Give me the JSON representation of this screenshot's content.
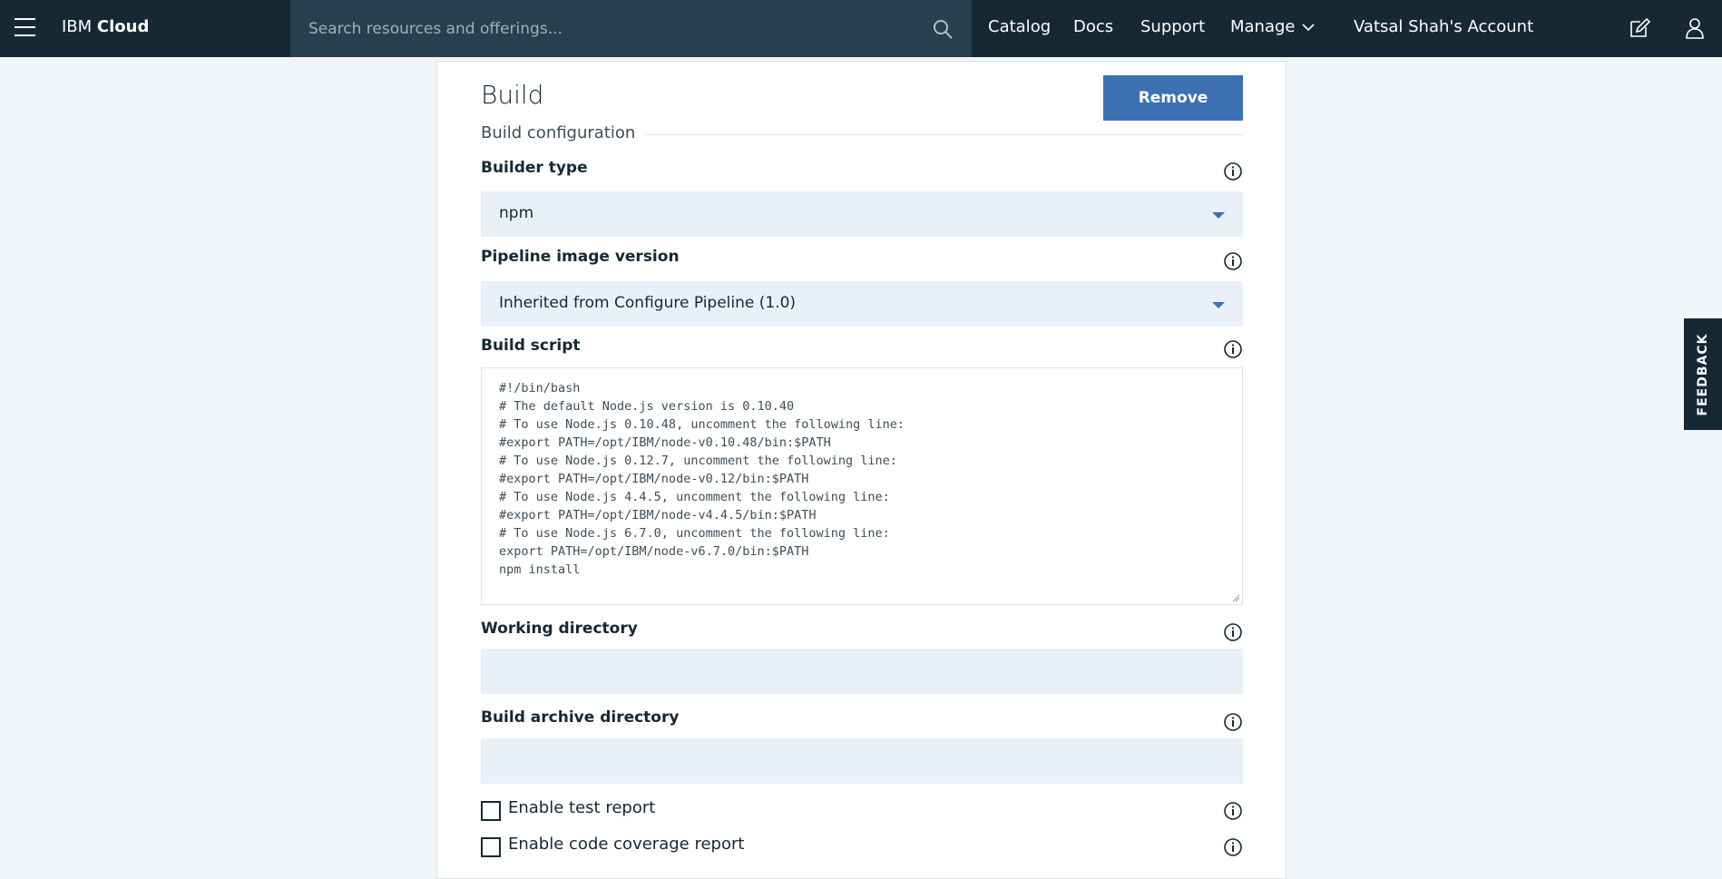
{
  "header": {
    "brand_prefix": "IBM",
    "brand_name": "Cloud",
    "search_placeholder": "Search resources and offerings...",
    "nav": {
      "catalog": "Catalog",
      "docs": "Docs",
      "support": "Support",
      "manage": "Manage",
      "account": "Vatsal Shah's Account"
    }
  },
  "panel": {
    "title": "Build",
    "remove_label": "Remove",
    "section_title": "Build configuration",
    "builder_type": {
      "label": "Builder type",
      "value": "npm"
    },
    "pipeline_image": {
      "label": "Pipeline image version",
      "value": "Inherited from Configure Pipeline (1.0)"
    },
    "build_script": {
      "label": "Build script",
      "value": "#!/bin/bash\n# The default Node.js version is 0.10.40\n# To use Node.js 0.10.48, uncomment the following line:\n#export PATH=/opt/IBM/node-v0.10.48/bin:$PATH\n# To use Node.js 0.12.7, uncomment the following line:\n#export PATH=/opt/IBM/node-v0.12/bin:$PATH\n# To use Node.js 4.4.5, uncomment the following line:\n#export PATH=/opt/IBM/node-v4.4.5/bin:$PATH\n# To use Node.js 6.7.0, uncomment the following line:\nexport PATH=/opt/IBM/node-v6.7.0/bin:$PATH\nnpm install"
    },
    "working_directory": {
      "label": "Working directory",
      "value": ""
    },
    "build_archive_directory": {
      "label": "Build archive directory",
      "value": ""
    },
    "enable_test_report": {
      "label": "Enable test report",
      "checked": false
    },
    "enable_code_coverage": {
      "label": "Enable code coverage report",
      "checked": false
    }
  },
  "feedback_label": "FEEDBACK",
  "icons": {
    "menu": "hamburger-menu-icon",
    "search": "search-icon",
    "manage_chevron": "chevron-down-icon",
    "edit": "edit-icon",
    "user": "user-icon",
    "info": "info-icon"
  },
  "colors": {
    "topbar": "#152935",
    "search_bg": "#26404f",
    "primary_button": "#3d70b2",
    "field_bg": "#eaf0f8",
    "page_bg": "#f0f5fa"
  }
}
